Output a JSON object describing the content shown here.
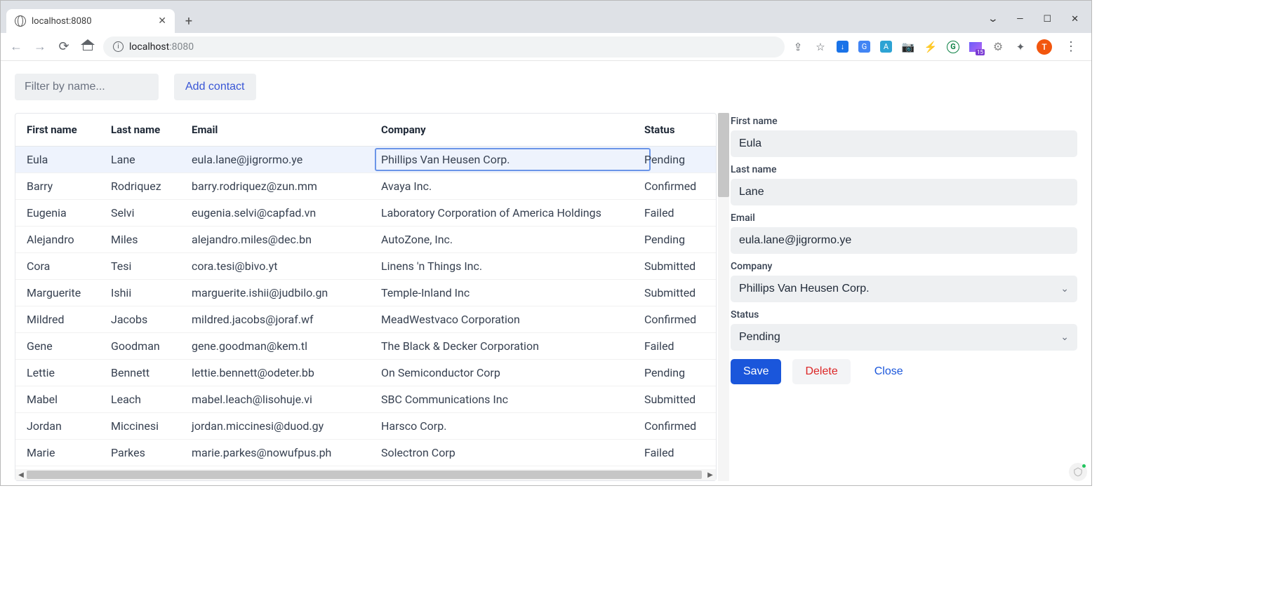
{
  "browser": {
    "tab_title": "localhost:8080",
    "url_host": "localhost",
    "url_port": ":8080",
    "avatar_initial": "T",
    "ext_badge": "15"
  },
  "controls": {
    "filter_placeholder": "Filter by name...",
    "add_contact_label": "Add contact"
  },
  "columns": {
    "first_name": "First name",
    "last_name": "Last name",
    "email": "Email",
    "company": "Company",
    "status": "Status"
  },
  "rows": [
    {
      "first": "Eula",
      "last": "Lane",
      "email": "eula.lane@jigrormo.ye",
      "company": "Phillips Van Heusen Corp.",
      "status": "Pending",
      "selected": true
    },
    {
      "first": "Barry",
      "last": "Rodriquez",
      "email": "barry.rodriquez@zun.mm",
      "company": "Avaya Inc.",
      "status": "Confirmed"
    },
    {
      "first": "Eugenia",
      "last": "Selvi",
      "email": "eugenia.selvi@capfad.vn",
      "company": "Laboratory Corporation of America Holdings",
      "status": "Failed"
    },
    {
      "first": "Alejandro",
      "last": "Miles",
      "email": "alejandro.miles@dec.bn",
      "company": "AutoZone, Inc.",
      "status": "Pending"
    },
    {
      "first": "Cora",
      "last": "Tesi",
      "email": "cora.tesi@bivo.yt",
      "company": "Linens 'n Things Inc.",
      "status": "Submitted"
    },
    {
      "first": "Marguerite",
      "last": "Ishii",
      "email": "marguerite.ishii@judbilo.gn",
      "company": "Temple-Inland Inc",
      "status": "Submitted"
    },
    {
      "first": "Mildred",
      "last": "Jacobs",
      "email": "mildred.jacobs@joraf.wf",
      "company": "MeadWestvaco Corporation",
      "status": "Confirmed"
    },
    {
      "first": "Gene",
      "last": "Goodman",
      "email": "gene.goodman@kem.tl",
      "company": "The Black & Decker Corporation",
      "status": "Failed"
    },
    {
      "first": "Lettie",
      "last": "Bennett",
      "email": "lettie.bennett@odeter.bb",
      "company": "On Semiconductor Corp",
      "status": "Pending"
    },
    {
      "first": "Mabel",
      "last": "Leach",
      "email": "mabel.leach@lisohuje.vi",
      "company": "SBC Communications Inc",
      "status": "Submitted"
    },
    {
      "first": "Jordan",
      "last": "Miccinesi",
      "email": "jordan.miccinesi@duod.gy",
      "company": "Harsco Corp.",
      "status": "Confirmed"
    },
    {
      "first": "Marie",
      "last": "Parkes",
      "email": "marie.parkes@nowufpus.ph",
      "company": "Solectron Corp",
      "status": "Failed"
    }
  ],
  "form": {
    "first_name_label": "First name",
    "last_name_label": "Last name",
    "email_label": "Email",
    "company_label": "Company",
    "status_label": "Status",
    "first_name_value": "Eula",
    "last_name_value": "Lane",
    "email_value": "eula.lane@jigrormo.ye",
    "company_value": "Phillips Van Heusen Corp.",
    "status_value": "Pending",
    "save_label": "Save",
    "delete_label": "Delete",
    "close_label": "Close"
  }
}
